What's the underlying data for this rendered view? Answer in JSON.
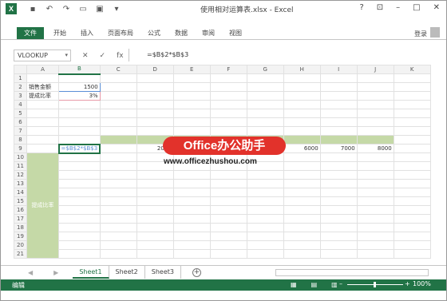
{
  "title_bar": {
    "app_icon": "X",
    "document_title": "使用相对运算表.xlsx - Excel",
    "quick_access_icons": [
      "save-icon",
      "undo-icon",
      "redo-icon",
      "print-preview-icon",
      "save-as-icon",
      "customize-icon"
    ],
    "window_controls": {
      "help": "?",
      "ribbon_display": "⊡",
      "minimize": "–",
      "restore": "□",
      "close": "✕"
    }
  },
  "ribbon": {
    "tabs": [
      "文件",
      "开始",
      "插入",
      "页面布局",
      "公式",
      "数据",
      "审阅",
      "视图"
    ],
    "login": "登录"
  },
  "formula_bar": {
    "name_box": "VLOOKUP",
    "cancel_icon": "✕",
    "enter_icon": "✓",
    "fx_label": "fx",
    "formula": "=$B$2*$B$3"
  },
  "columns": [
    "A",
    "B",
    "C",
    "D",
    "E",
    "F",
    "G",
    "H",
    "I",
    "J",
    "K"
  ],
  "rows": {
    "2": {
      "A": "销售金额",
      "B": "1500"
    },
    "3": {
      "A": "提成比率",
      "B": "3%"
    },
    "9": {
      "B": "=$B$2*$B$3",
      "D": "2000",
      "H": "6000",
      "I": "7000",
      "J": "8000"
    },
    "15": {
      "A": "提成比率"
    }
  },
  "row_numbers": [
    "1",
    "2",
    "3",
    "4",
    "5",
    "6",
    "7",
    "8",
    "9",
    "10",
    "11",
    "12",
    "13",
    "14",
    "15",
    "16",
    "17",
    "18",
    "19",
    "20",
    "21"
  ],
  "watermark": {
    "brand": "Office办公助手",
    "url": "www.officezhushou.com"
  },
  "sheet_tabs": [
    "Sheet1",
    "Sheet2",
    "Sheet3"
  ],
  "active_sheet": "Sheet1",
  "status_bar": {
    "mode": "编辑",
    "zoom": "100%"
  },
  "colors": {
    "excel_green": "#217346",
    "highlight_green": "#c5d9a7",
    "watermark_red": "#e2322b"
  }
}
